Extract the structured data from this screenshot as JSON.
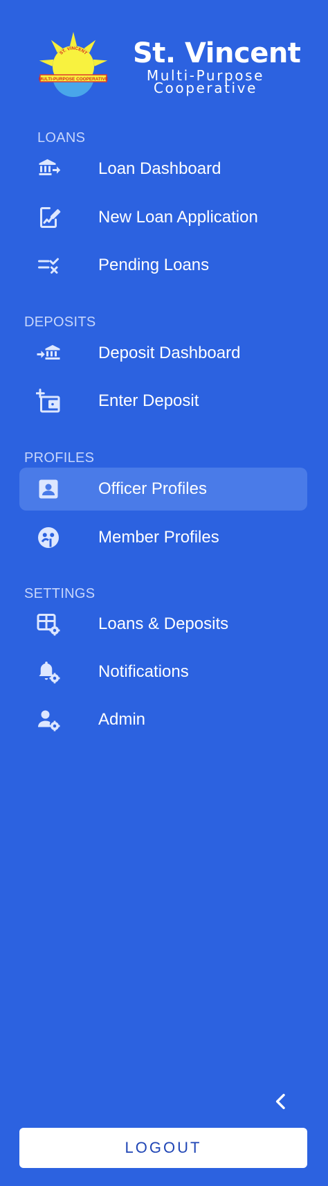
{
  "brand": {
    "title": "St. Vincent",
    "subtitle_line1": "Multi-Purpose",
    "subtitle_line2": "Cooperative",
    "logo_icon": "sun-logo-icon",
    "logo_text": "ST. VINCENT MULTI-PURPOSE COOPERATIVE"
  },
  "colors": {
    "sidebar_bg": "#2c62e0",
    "active_item_bg": "#4a7be8",
    "section_heading": "#c7d6fb",
    "icon": "#dde7ff",
    "logout_text": "#1f45b5"
  },
  "sections": {
    "loans": {
      "heading": "LOANS",
      "items": [
        {
          "label": "Loan Dashboard",
          "icon": "bank-arrow-icon"
        },
        {
          "label": "New Loan Application",
          "icon": "document-edit-icon"
        },
        {
          "label": "Pending Loans",
          "icon": "checklist-pending-icon"
        }
      ]
    },
    "deposits": {
      "heading": "DEPOSITS",
      "items": [
        {
          "label": "Deposit Dashboard",
          "icon": "arrow-bank-icon"
        },
        {
          "label": "Enter Deposit",
          "icon": "wallet-add-icon"
        }
      ]
    },
    "profiles": {
      "heading": "PROFILES",
      "items": [
        {
          "label": "Officer Profiles",
          "icon": "contact-card-icon",
          "active": true
        },
        {
          "label": "Member Profiles",
          "icon": "member-face-icon"
        }
      ]
    },
    "settings": {
      "heading": "SETTINGS",
      "items": [
        {
          "label": "Loans & Deposits",
          "icon": "table-settings-icon"
        },
        {
          "label": "Notifications",
          "icon": "bell-settings-icon"
        },
        {
          "label": "Admin",
          "icon": "user-settings-icon"
        }
      ]
    }
  },
  "footer": {
    "collapse_icon": "chevron-left-icon",
    "logout_label": "LOGOUT"
  }
}
